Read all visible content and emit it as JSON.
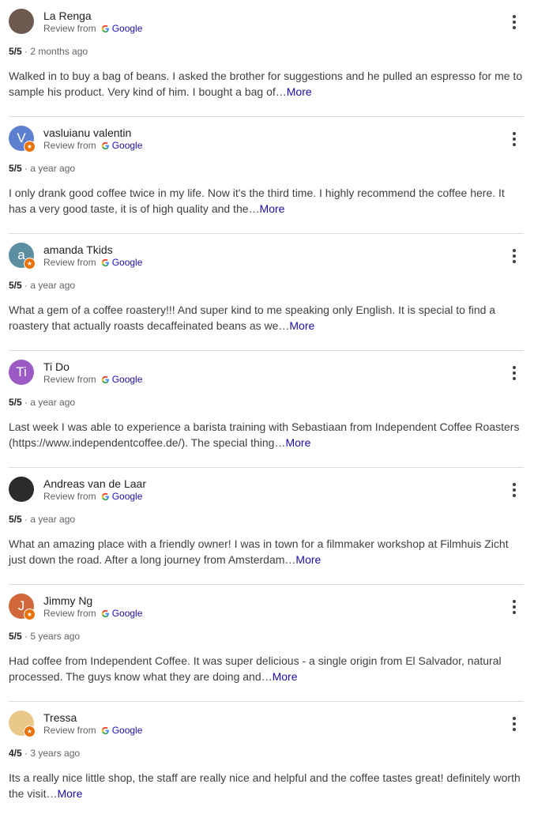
{
  "source_label": "Review from",
  "source_brand": "Google",
  "more_label": "More",
  "reviews": [
    {
      "name": "La Renga",
      "initial": "",
      "avatar_color": "#6d5a4e",
      "local_guide": false,
      "rating": "5/5",
      "time": "2 months ago",
      "text": "Walked in to buy a bag of beans. I asked the brother for suggestions and he pulled an espresso for me to sample his product. Very kind of him. I bought a bag of…"
    },
    {
      "name": "vasluianu valentin",
      "initial": "V",
      "avatar_color": "#5c7fd0",
      "local_guide": true,
      "rating": "5/5",
      "time": "a year ago",
      "text": "I only drank good coffee twice in my life. Now it's the third time. I highly recommend the coffee here. It has a very good taste, it is of high quality and the…"
    },
    {
      "name": "amanda Tkids",
      "initial": "a",
      "avatar_color": "#5d8fa3",
      "local_guide": true,
      "rating": "5/5",
      "time": "a year ago",
      "text": "What a gem of a coffee roastery!!! And super kind to me speaking only English. It is special to find a roastery that actually roasts decaffeinated beans as we…"
    },
    {
      "name": "Ti Do",
      "initial": "Ti",
      "avatar_color": "#9c5bc4",
      "local_guide": false,
      "rating": "5/5",
      "time": "a year ago",
      "text": "Last week I was able to experience a barista training with Sebastiaan from Independent Coffee Roasters (https://www.independentcoffee.de/). The special thing…"
    },
    {
      "name": "Andreas van de Laar",
      "initial": "",
      "avatar_color": "#2b2b2b",
      "local_guide": false,
      "rating": "5/5",
      "time": "a year ago",
      "text": "What an amazing place with a friendly owner! I was in town for a filmmaker workshop at Filmhuis Zicht just down the road. After a long journey from Amsterdam…"
    },
    {
      "name": "Jimmy Ng",
      "initial": "J",
      "avatar_color": "#d0683b",
      "local_guide": true,
      "rating": "5/5",
      "time": "5 years ago",
      "text": "Had coffee from Independent Coffee. It was super delicious - a single origin from El Salvador, natural processed. The guys know what they are doing and…"
    },
    {
      "name": "Tressa",
      "initial": "",
      "avatar_color": "#e9c88a",
      "local_guide": true,
      "rating": "4/5",
      "time": "3 years ago",
      "text": "Its a really nice little shop, the staff are really nice and helpful and the coffee tastes great! definitely worth the visit…"
    }
  ]
}
